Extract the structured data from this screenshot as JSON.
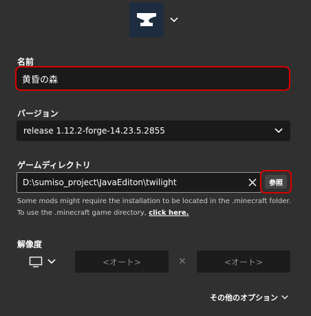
{
  "profile_icon": {
    "icon": "anvil-icon",
    "tile_color": "#1d2d3f",
    "chevron": "chevron-down-icon"
  },
  "name": {
    "label": "名前",
    "value": "黄昏の森"
  },
  "version": {
    "label": "バージョン",
    "selected": "release 1.12.2-forge-14.23.5.2855"
  },
  "game_directory": {
    "label": "ゲームディレクトリ",
    "value": "D:\\sumiso_project\\JavaEditon\\twilight",
    "browse_label": "参照",
    "help_text": "Some mods might require the installation to be located in the .minecraft folder. To use the .minecraft game directory, ",
    "help_link": "click here."
  },
  "resolution": {
    "label": "解像度",
    "width_placeholder": "<オート>",
    "height_placeholder": "<オート>",
    "separator": "✕"
  },
  "more_options": {
    "label": "その他のオプション"
  },
  "colors": {
    "background": "#303030",
    "field": "#1a1a1a",
    "highlight_red": "#d80000"
  }
}
